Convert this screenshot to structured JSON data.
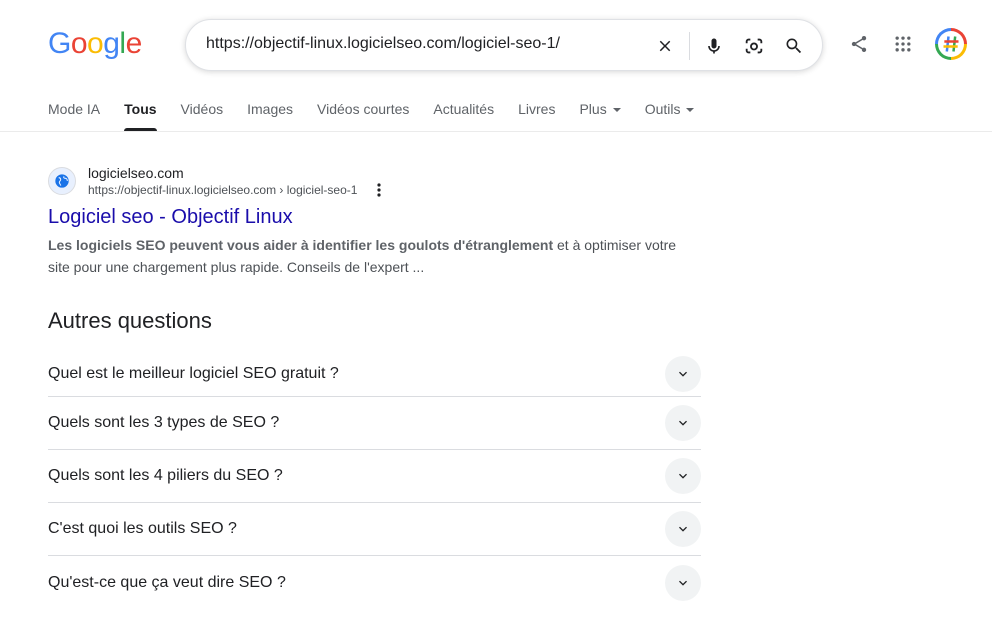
{
  "logo": {
    "letters": [
      "G",
      "o",
      "o",
      "g",
      "l",
      "e"
    ],
    "colors": [
      "#4285f4",
      "#ea4335",
      "#fbbc04",
      "#4285f4",
      "#34a853",
      "#ea4335"
    ]
  },
  "search": {
    "query": "https://objectif-linux.logicielseo.com/logiciel-seo-1/"
  },
  "tabs": [
    {
      "label": "Mode IA"
    },
    {
      "label": "Tous"
    },
    {
      "label": "Vidéos"
    },
    {
      "label": "Images"
    },
    {
      "label": "Vidéos courtes"
    },
    {
      "label": "Actualités"
    },
    {
      "label": "Livres"
    },
    {
      "label": "Plus"
    },
    {
      "label": "Outils"
    }
  ],
  "active_tab": "Tous",
  "result": {
    "site_name": "logicielseo.com",
    "url": "https://objectif-linux.logicielseo.com › logiciel-seo-1",
    "title": "Logiciel seo - Objectif Linux",
    "snippet_bold": "Les logiciels SEO peuvent vous aider à identifier les goulots d'étranglement",
    "snippet_rest": " et à optimiser votre site pour une chargement plus rapide. Conseils de l'expert ..."
  },
  "paa": {
    "title": "Autres questions",
    "questions": [
      "Quel est le meilleur logiciel SEO gratuit ?",
      "Quels sont les 3 types de SEO ?",
      "Quels sont les 4 piliers du SEO ?",
      "C'est quoi les outils SEO ?",
      "Qu'est-ce que ça veut dire SEO ?"
    ]
  },
  "colors": {
    "link": "#1a0dab",
    "text": "#202124",
    "muted": "#5f6368"
  }
}
